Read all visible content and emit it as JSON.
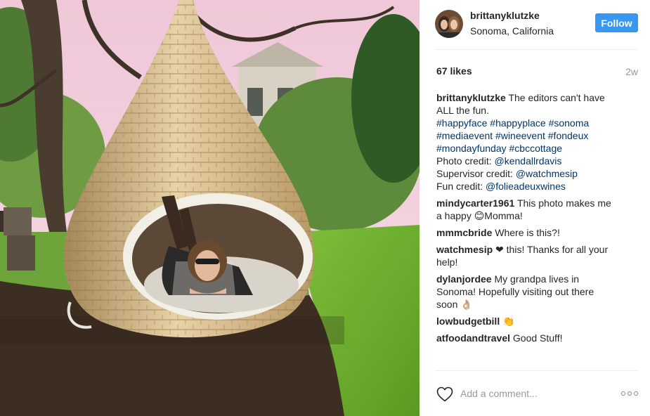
{
  "post": {
    "image_alt": "Woman lying inside a woven hanging nest pod chair in a garden",
    "header": {
      "username": "brittanyklutzke",
      "location": "Sonoma, California",
      "follow_label": "Follow"
    },
    "likes": "67 likes",
    "time_ago": "2w",
    "caption": {
      "author": "brittanyklutzke",
      "text_line1": "The editors can't have",
      "text_line2": "ALL the fun.",
      "hashtags_line1": "#happyface #happyplace #sonoma",
      "hashtags_line2": "#mediaevent #wineevent #fondeux",
      "hashtags_line3": "#mondayfunday #cbccottage",
      "photo_credit_label": "Photo credit:",
      "photo_credit_handle": "@kendallrdavis",
      "supervisor_credit_label": "Supervisor credit:",
      "supervisor_credit_handle": "@watchmesip",
      "fun_credit_label": "Fun credit:",
      "fun_credit_handle": "@folieadeuxwines"
    },
    "comments": [
      {
        "author": "mindycarter1961",
        "line1": "This photo makes me",
        "line2": "a happy 😊Momma!"
      },
      {
        "author": "mmmcbride",
        "line1": "Where is this?!"
      },
      {
        "author": "watchmesip",
        "line1": "❤ this! Thanks for all your",
        "line2": "help!"
      },
      {
        "author": "dylanjordee",
        "line1": "My grandpa lives in",
        "line2": "Sonoma! Hopefully visiting out there",
        "line3": "soon 👌🏼"
      },
      {
        "author": "lowbudgetbill",
        "line1": "👏"
      },
      {
        "author": "atfoodandtravel",
        "line1": "Good Stuff!"
      }
    ],
    "footer": {
      "comment_placeholder": "Add a comment..."
    }
  },
  "icons": {
    "like": "heart-outline-icon",
    "more": "more-options-icon"
  },
  "colors": {
    "follow_button": "#3897f0",
    "link": "#003569",
    "muted": "#999999"
  }
}
